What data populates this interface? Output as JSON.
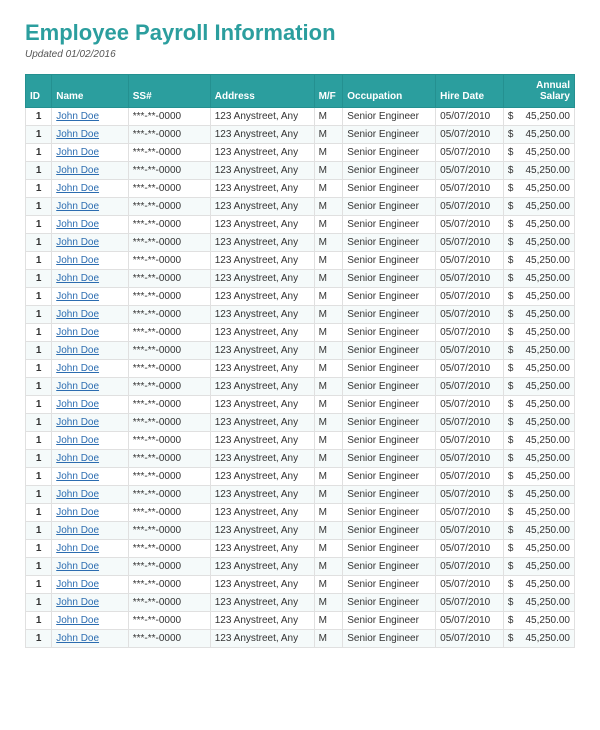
{
  "header": {
    "title": "Employee Payroll Information",
    "updated": "Updated 01/02/2016"
  },
  "table": {
    "columns": [
      {
        "label": "ID",
        "key": "id"
      },
      {
        "label": "Name",
        "key": "name"
      },
      {
        "label": "SS#",
        "key": "ss"
      },
      {
        "label": "Address",
        "key": "address"
      },
      {
        "label": "M/F",
        "key": "mf"
      },
      {
        "label": "Occupation",
        "key": "occupation"
      },
      {
        "label": "Hire Date",
        "key": "hireDate"
      },
      {
        "label": "Annual\nSalary",
        "key": "salary"
      }
    ],
    "rows": [
      {
        "id": "1",
        "name": "John Doe",
        "ss": "***-**-0000",
        "address": "123 Anystreet, Any",
        "mf": "M",
        "occupation": "Senior Engineer",
        "hireDate": "05/07/2010",
        "salary": "45,250.00"
      },
      {
        "id": "1",
        "name": "John Doe",
        "ss": "***-**-0000",
        "address": "123 Anystreet, Any",
        "mf": "M",
        "occupation": "Senior Engineer",
        "hireDate": "05/07/2010",
        "salary": "45,250.00"
      },
      {
        "id": "1",
        "name": "John Doe",
        "ss": "***-**-0000",
        "address": "123 Anystreet, Any",
        "mf": "M",
        "occupation": "Senior Engineer",
        "hireDate": "05/07/2010",
        "salary": "45,250.00"
      },
      {
        "id": "1",
        "name": "John Doe",
        "ss": "***-**-0000",
        "address": "123 Anystreet, Any",
        "mf": "M",
        "occupation": "Senior Engineer",
        "hireDate": "05/07/2010",
        "salary": "45,250.00"
      },
      {
        "id": "1",
        "name": "John Doe",
        "ss": "***-**-0000",
        "address": "123 Anystreet, Any",
        "mf": "M",
        "occupation": "Senior Engineer",
        "hireDate": "05/07/2010",
        "salary": "45,250.00"
      },
      {
        "id": "1",
        "name": "John Doe",
        "ss": "***-**-0000",
        "address": "123 Anystreet, Any",
        "mf": "M",
        "occupation": "Senior Engineer",
        "hireDate": "05/07/2010",
        "salary": "45,250.00"
      },
      {
        "id": "1",
        "name": "John Doe",
        "ss": "***-**-0000",
        "address": "123 Anystreet, Any",
        "mf": "M",
        "occupation": "Senior Engineer",
        "hireDate": "05/07/2010",
        "salary": "45,250.00"
      },
      {
        "id": "1",
        "name": "John Doe",
        "ss": "***-**-0000",
        "address": "123 Anystreet, Any",
        "mf": "M",
        "occupation": "Senior Engineer",
        "hireDate": "05/07/2010",
        "salary": "45,250.00"
      },
      {
        "id": "1",
        "name": "John Doe",
        "ss": "***-**-0000",
        "address": "123 Anystreet, Any",
        "mf": "M",
        "occupation": "Senior Engineer",
        "hireDate": "05/07/2010",
        "salary": "45,250.00"
      },
      {
        "id": "1",
        "name": "John Doe",
        "ss": "***-**-0000",
        "address": "123 Anystreet, Any",
        "mf": "M",
        "occupation": "Senior Engineer",
        "hireDate": "05/07/2010",
        "salary": "45,250.00"
      },
      {
        "id": "1",
        "name": "John Doe",
        "ss": "***-**-0000",
        "address": "123 Anystreet, Any",
        "mf": "M",
        "occupation": "Senior Engineer",
        "hireDate": "05/07/2010",
        "salary": "45,250.00"
      },
      {
        "id": "1",
        "name": "John Doe",
        "ss": "***-**-0000",
        "address": "123 Anystreet, Any",
        "mf": "M",
        "occupation": "Senior Engineer",
        "hireDate": "05/07/2010",
        "salary": "45,250.00"
      },
      {
        "id": "1",
        "name": "John Doe",
        "ss": "***-**-0000",
        "address": "123 Anystreet, Any",
        "mf": "M",
        "occupation": "Senior Engineer",
        "hireDate": "05/07/2010",
        "salary": "45,250.00"
      },
      {
        "id": "1",
        "name": "John Doe",
        "ss": "***-**-0000",
        "address": "123 Anystreet, Any",
        "mf": "M",
        "occupation": "Senior Engineer",
        "hireDate": "05/07/2010",
        "salary": "45,250.00"
      },
      {
        "id": "1",
        "name": "John Doe",
        "ss": "***-**-0000",
        "address": "123 Anystreet, Any",
        "mf": "M",
        "occupation": "Senior Engineer",
        "hireDate": "05/07/2010",
        "salary": "45,250.00"
      },
      {
        "id": "1",
        "name": "John Doe",
        "ss": "***-**-0000",
        "address": "123 Anystreet, Any",
        "mf": "M",
        "occupation": "Senior Engineer",
        "hireDate": "05/07/2010",
        "salary": "45,250.00"
      },
      {
        "id": "1",
        "name": "John Doe",
        "ss": "***-**-0000",
        "address": "123 Anystreet, Any",
        "mf": "M",
        "occupation": "Senior Engineer",
        "hireDate": "05/07/2010",
        "salary": "45,250.00"
      },
      {
        "id": "1",
        "name": "John Doe",
        "ss": "***-**-0000",
        "address": "123 Anystreet, Any",
        "mf": "M",
        "occupation": "Senior Engineer",
        "hireDate": "05/07/2010",
        "salary": "45,250.00"
      },
      {
        "id": "1",
        "name": "John Doe",
        "ss": "***-**-0000",
        "address": "123 Anystreet, Any",
        "mf": "M",
        "occupation": "Senior Engineer",
        "hireDate": "05/07/2010",
        "salary": "45,250.00"
      },
      {
        "id": "1",
        "name": "John Doe",
        "ss": "***-**-0000",
        "address": "123 Anystreet, Any",
        "mf": "M",
        "occupation": "Senior Engineer",
        "hireDate": "05/07/2010",
        "salary": "45,250.00"
      },
      {
        "id": "1",
        "name": "John Doe",
        "ss": "***-**-0000",
        "address": "123 Anystreet, Any",
        "mf": "M",
        "occupation": "Senior Engineer",
        "hireDate": "05/07/2010",
        "salary": "45,250.00"
      },
      {
        "id": "1",
        "name": "John Doe",
        "ss": "***-**-0000",
        "address": "123 Anystreet, Any",
        "mf": "M",
        "occupation": "Senior Engineer",
        "hireDate": "05/07/2010",
        "salary": "45,250.00"
      },
      {
        "id": "1",
        "name": "John Doe",
        "ss": "***-**-0000",
        "address": "123 Anystreet, Any",
        "mf": "M",
        "occupation": "Senior Engineer",
        "hireDate": "05/07/2010",
        "salary": "45,250.00"
      },
      {
        "id": "1",
        "name": "John Doe",
        "ss": "***-**-0000",
        "address": "123 Anystreet, Any",
        "mf": "M",
        "occupation": "Senior Engineer",
        "hireDate": "05/07/2010",
        "salary": "45,250.00"
      },
      {
        "id": "1",
        "name": "John Doe",
        "ss": "***-**-0000",
        "address": "123 Anystreet, Any",
        "mf": "M",
        "occupation": "Senior Engineer",
        "hireDate": "05/07/2010",
        "salary": "45,250.00"
      },
      {
        "id": "1",
        "name": "John Doe",
        "ss": "***-**-0000",
        "address": "123 Anystreet, Any",
        "mf": "M",
        "occupation": "Senior Engineer",
        "hireDate": "05/07/2010",
        "salary": "45,250.00"
      },
      {
        "id": "1",
        "name": "John Doe",
        "ss": "***-**-0000",
        "address": "123 Anystreet, Any",
        "mf": "M",
        "occupation": "Senior Engineer",
        "hireDate": "05/07/2010",
        "salary": "45,250.00"
      },
      {
        "id": "1",
        "name": "John Doe",
        "ss": "***-**-0000",
        "address": "123 Anystreet, Any",
        "mf": "M",
        "occupation": "Senior Engineer",
        "hireDate": "05/07/2010",
        "salary": "45,250.00"
      },
      {
        "id": "1",
        "name": "John Doe",
        "ss": "***-**-0000",
        "address": "123 Anystreet, Any",
        "mf": "M",
        "occupation": "Senior Engineer",
        "hireDate": "05/07/2010",
        "salary": "45,250.00"
      },
      {
        "id": "1",
        "name": "John Doe",
        "ss": "***-**-0000",
        "address": "123 Anystreet, Any",
        "mf": "M",
        "occupation": "Senior Engineer",
        "hireDate": "05/07/2010",
        "salary": "45,250.00"
      }
    ]
  }
}
